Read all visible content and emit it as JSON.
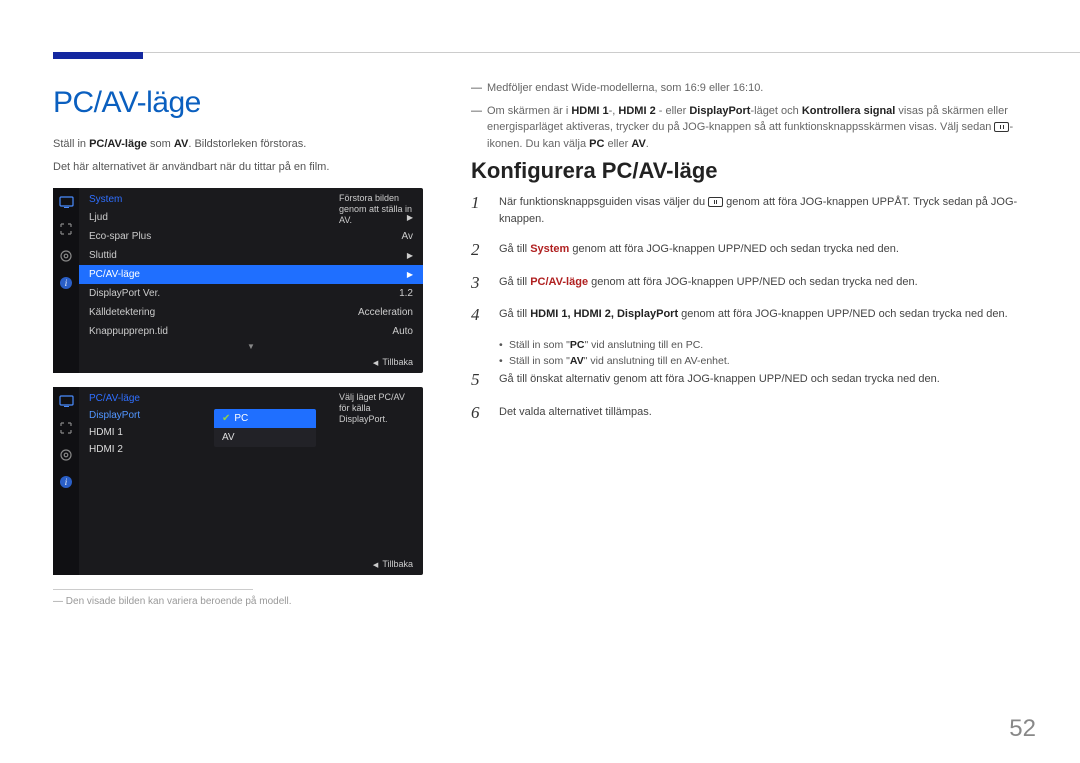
{
  "page_number": "52",
  "left": {
    "title": "PC/AV-läge",
    "intro_pre": "Ställ in ",
    "intro_mode": "PC/AV-läge",
    "intro_mid": " som ",
    "intro_val": "AV",
    "intro_post": ". Bildstorleken förstoras.",
    "intro_line2": "Det här alternativet är användbart när du tittar på en film.",
    "footnote": "Den visade bilden kan variera beroende på modell."
  },
  "osd1": {
    "header": "System",
    "desc": "Förstora bilden genom att ställa in AV.",
    "rows": [
      {
        "label": "Ljud",
        "value": "",
        "arrow": true
      },
      {
        "label": "Eco-spar Plus",
        "value": "Av",
        "arrow": false
      },
      {
        "label": "Sluttid",
        "value": "",
        "arrow": true
      },
      {
        "label": "PC/AV-läge",
        "value": "",
        "arrow": true,
        "hl": true
      },
      {
        "label": "DisplayPort Ver.",
        "value": "1.2",
        "arrow": false
      },
      {
        "label": "Källdetektering",
        "value": "Acceleration",
        "arrow": false
      },
      {
        "label": "Knappupprepn.tid",
        "value": "Auto",
        "arrow": false
      }
    ],
    "back": "Tillbaka"
  },
  "osd2": {
    "header": "PC/AV-läge",
    "items": [
      "DisplayPort",
      "HDMI 1",
      "HDMI 2"
    ],
    "sub": {
      "opts": [
        "PC",
        "AV"
      ],
      "selected": "PC"
    },
    "desc": "Välj läget PC/AV för källa DisplayPort.",
    "back": "Tillbaka"
  },
  "right": {
    "note1": "Medföljer endast Wide-modellerna, som 16:9 eller 16:10.",
    "note2_pre": "Om skärmen är i ",
    "note2_h1": "HDMI 1",
    "note2_sep1": "-, ",
    "note2_h2": "HDMI 2",
    "note2_sep2": " - eller ",
    "note2_dp": "DisplayPort",
    "note2_mid": "-läget och ",
    "note2_ks": "Kontrollera signal",
    "note2_post1": " visas på skärmen eller energisparläget aktiveras, trycker du på JOG-knappen så att funktionsknappsskärmen visas. Välj sedan ",
    "note2_post2": "-ikonen. Du kan välja ",
    "note2_pc": "PC",
    "note2_or": " eller ",
    "note2_av": "AV",
    "note2_end": ".",
    "subtitle": "Konfigurera PC/AV-läge",
    "steps": [
      {
        "n": "1",
        "pre": "När funktionsknappsguiden visas väljer du ",
        "post": " genom att föra JOG-knappen UPPÅT. Tryck sedan på JOG-knappen.",
        "icon": true
      },
      {
        "n": "2",
        "pre": "Gå till ",
        "bold": "System",
        "bold_color": "#b02020",
        "post": " genom att föra JOG-knappen UPP/NED och sedan trycka ned den."
      },
      {
        "n": "3",
        "pre": "Gå till ",
        "bold": "PC/AV-läge",
        "bold_color": "#b02020",
        "post": " genom att föra JOG-knappen UPP/NED och sedan trycka ned den."
      },
      {
        "n": "4",
        "pre": "Gå till ",
        "bold": "HDMI 1, HDMI 2, DisplayPort",
        "bold_color": "#222",
        "post": " genom att föra JOG-knappen UPP/NED och sedan trycka ned den."
      },
      {
        "n": "5",
        "pre": "",
        "bold": "",
        "post": "Gå till önskat alternativ genom att föra JOG-knappen UPP/NED och sedan trycka ned den."
      },
      {
        "n": "6",
        "pre": "",
        "bold": "",
        "post": "Det valda alternativet tillämpas."
      }
    ],
    "bullets": [
      {
        "pre": "Ställ in som \"",
        "b": "PC",
        "post": "\" vid anslutning till en PC."
      },
      {
        "pre": "Ställ in som \"",
        "b": "AV",
        "post": "\" vid anslutning till en AV-enhet."
      }
    ]
  }
}
